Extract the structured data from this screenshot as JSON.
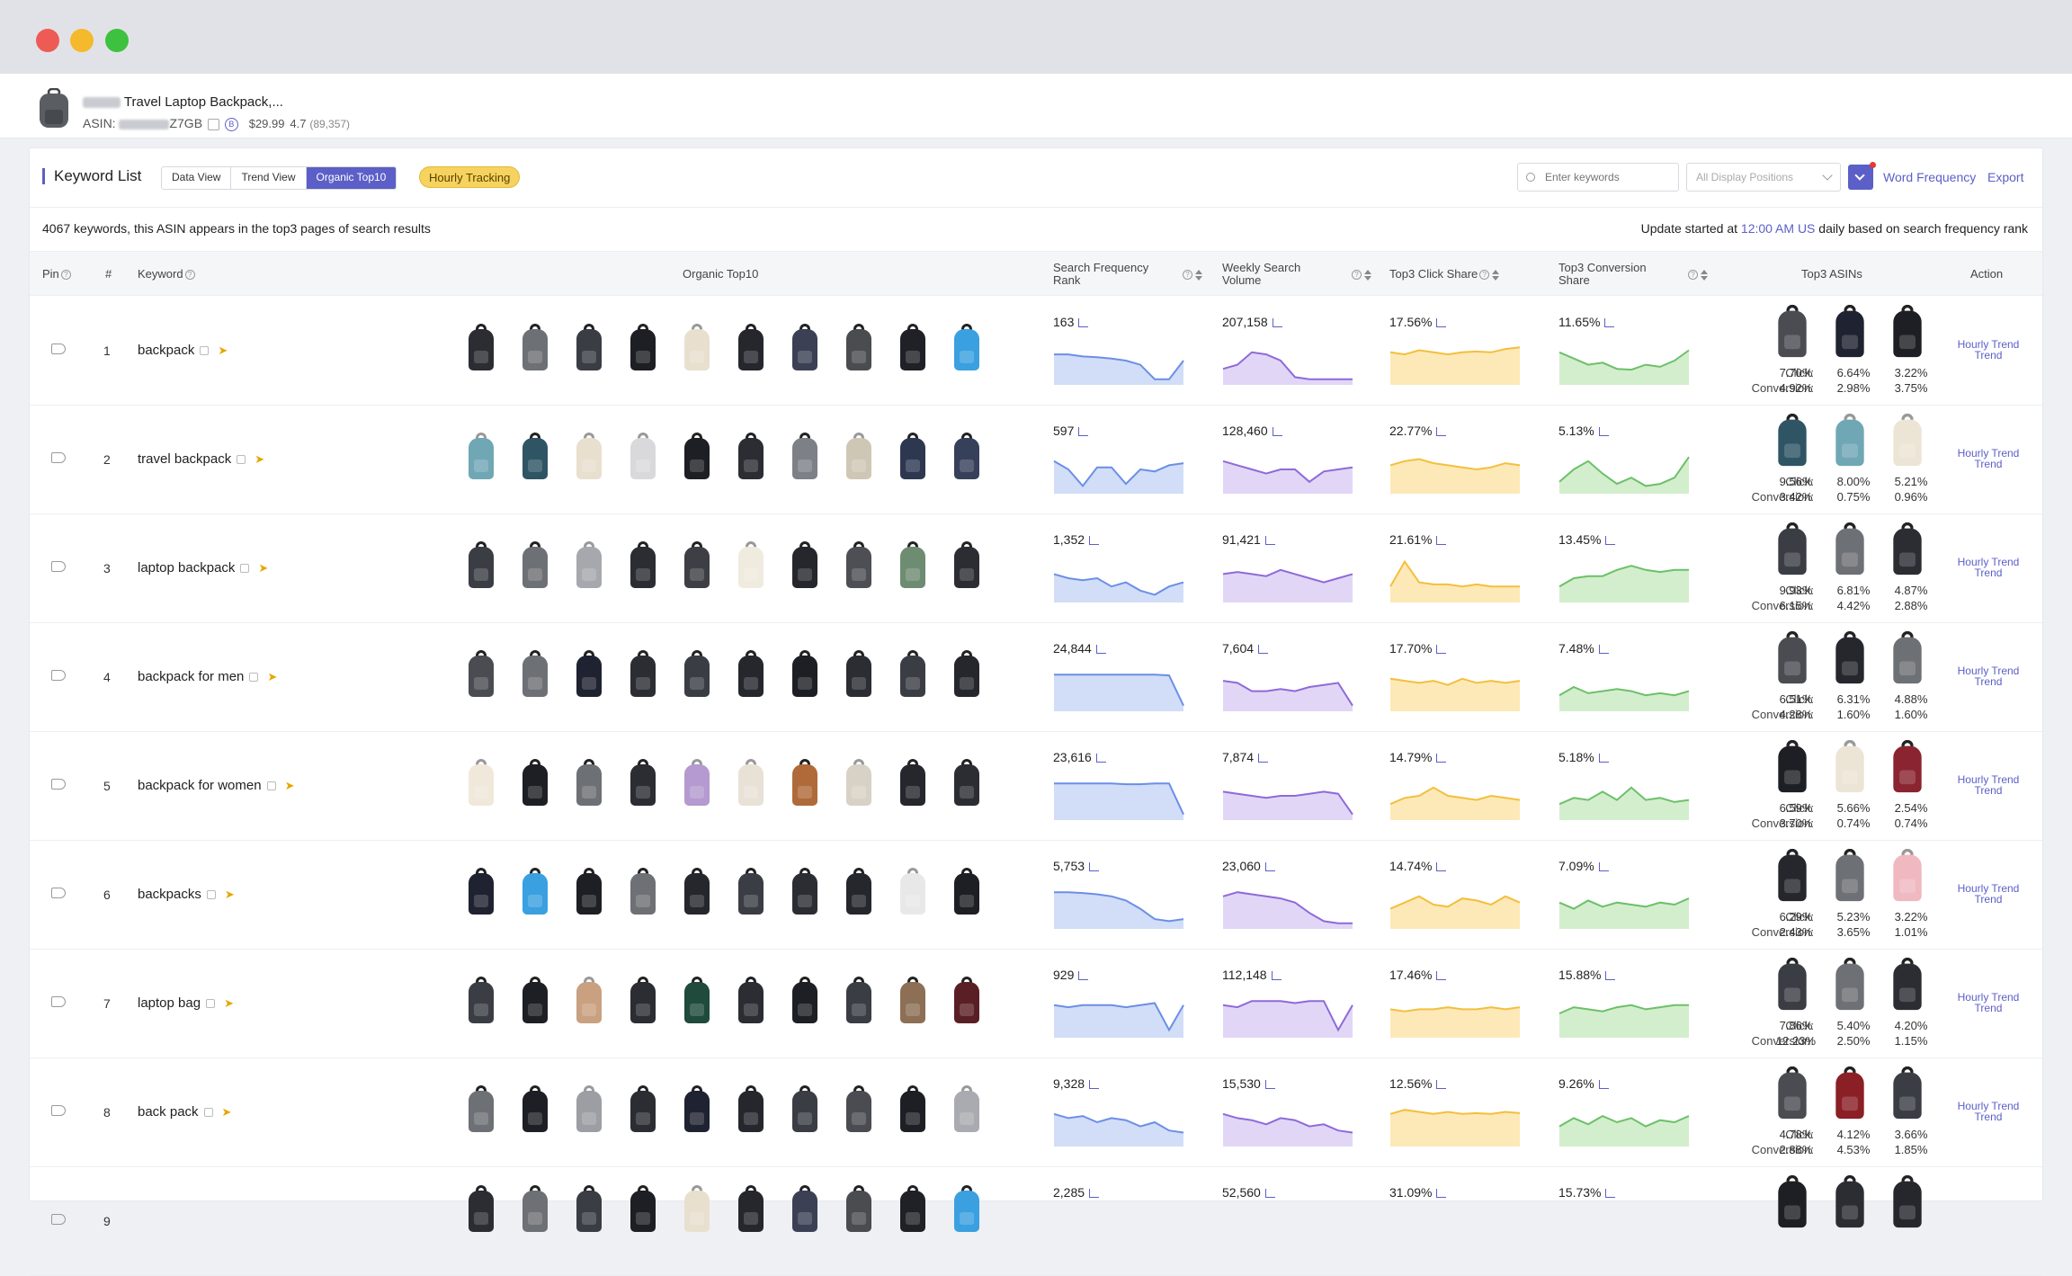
{
  "window": {
    "controls": [
      "close",
      "minimize",
      "maximize"
    ]
  },
  "product": {
    "title": "Travel Laptop Backpack,...",
    "asin_label": "ASIN:",
    "asin_suffix": "Z7GB",
    "price": "$29.99",
    "rating": "4.7",
    "reviews": "(89,357)"
  },
  "toolbar": {
    "title": "Keyword List",
    "tabs": [
      "Data View",
      "Trend View",
      "Organic Top10"
    ],
    "active_tab": "Organic Top10",
    "hourly_tracking": "Hourly Tracking",
    "search_placeholder": "Enter keywords",
    "display_positions": "All Display Positions",
    "word_frequency": "Word Frequency",
    "export": "Export"
  },
  "info": {
    "summary": "4067 keywords, this ASIN appears in the top3 pages of search results",
    "update_prefix": "Update started at",
    "update_time": "12:00 AM US",
    "update_suffix": "daily based on search frequency rank"
  },
  "columns": {
    "pin": "Pin",
    "num": "#",
    "keyword": "Keyword",
    "organic": "Organic Top10",
    "sfr": "Search Frequency Rank",
    "wsv": "Weekly Search Volume",
    "click_share": "Top3 Click Share",
    "conv_share": "Top3 Conversion Share",
    "top3": "Top3 ASINs",
    "action": "Action"
  },
  "labels": {
    "click": "Click:",
    "conversion": "Conversion:",
    "action_l1": "Hourly Trend",
    "action_l2": "Trend"
  },
  "colors": {
    "accent": "#5b5fc7",
    "blue": "#6b8fe6",
    "purple": "#8e6ad8",
    "yellow": "#f3bf3c",
    "green": "#6cc06a"
  },
  "rows": [
    {
      "n": "1",
      "kw": "backpack",
      "sfr": "163",
      "wsv": "207,158",
      "click": "17.56%",
      "conv": "11.65%",
      "ta_click": [
        "7.70%",
        "6.64%",
        "3.22%"
      ],
      "ta_conv": [
        "4.92%",
        "2.98%",
        "3.75%"
      ]
    },
    {
      "n": "2",
      "kw": "travel backpack",
      "sfr": "597",
      "wsv": "128,460",
      "click": "22.77%",
      "conv": "5.13%",
      "ta_click": [
        "9.56%",
        "8.00%",
        "5.21%"
      ],
      "ta_conv": [
        "3.42%",
        "0.75%",
        "0.96%"
      ]
    },
    {
      "n": "3",
      "kw": "laptop backpack",
      "sfr": "1,352",
      "wsv": "91,421",
      "click": "21.61%",
      "conv": "13.45%",
      "ta_click": [
        "9.93%",
        "6.81%",
        "4.87%"
      ],
      "ta_conv": [
        "6.15%",
        "4.42%",
        "2.88%"
      ]
    },
    {
      "n": "4",
      "kw": "backpack for men",
      "sfr": "24,844",
      "wsv": "7,604",
      "click": "17.70%",
      "conv": "7.48%",
      "ta_click": [
        "6.51%",
        "6.31%",
        "4.88%"
      ],
      "ta_conv": [
        "4.28%",
        "1.60%",
        "1.60%"
      ]
    },
    {
      "n": "5",
      "kw": "backpack for women",
      "sfr": "23,616",
      "wsv": "7,874",
      "click": "14.79%",
      "conv": "5.18%",
      "ta_click": [
        "6.59%",
        "5.66%",
        "2.54%"
      ],
      "ta_conv": [
        "3.70%",
        "0.74%",
        "0.74%"
      ]
    },
    {
      "n": "6",
      "kw": "backpacks",
      "sfr": "5,753",
      "wsv": "23,060",
      "click": "14.74%",
      "conv": "7.09%",
      "ta_click": [
        "6.29%",
        "5.23%",
        "3.22%"
      ],
      "ta_conv": [
        "2.43%",
        "3.65%",
        "1.01%"
      ]
    },
    {
      "n": "7",
      "kw": "laptop bag",
      "sfr": "929",
      "wsv": "112,148",
      "click": "17.46%",
      "conv": "15.88%",
      "ta_click": [
        "7.86%",
        "5.40%",
        "4.20%"
      ],
      "ta_conv": [
        "12.23%",
        "2.50%",
        "1.15%"
      ]
    },
    {
      "n": "8",
      "kw": "back pack",
      "sfr": "9,328",
      "wsv": "15,530",
      "click": "12.56%",
      "conv": "9.26%",
      "ta_click": [
        "4.78%",
        "4.12%",
        "3.66%"
      ],
      "ta_conv": [
        "2.88%",
        "4.53%",
        "1.85%"
      ]
    },
    {
      "n": "9",
      "kw": "",
      "sfr": "2,285",
      "wsv": "52,560",
      "click": "31.09%",
      "conv": "15.73%",
      "ta_click": [
        "",
        "",
        ""
      ],
      "ta_conv": [
        "",
        "",
        ""
      ]
    }
  ]
}
